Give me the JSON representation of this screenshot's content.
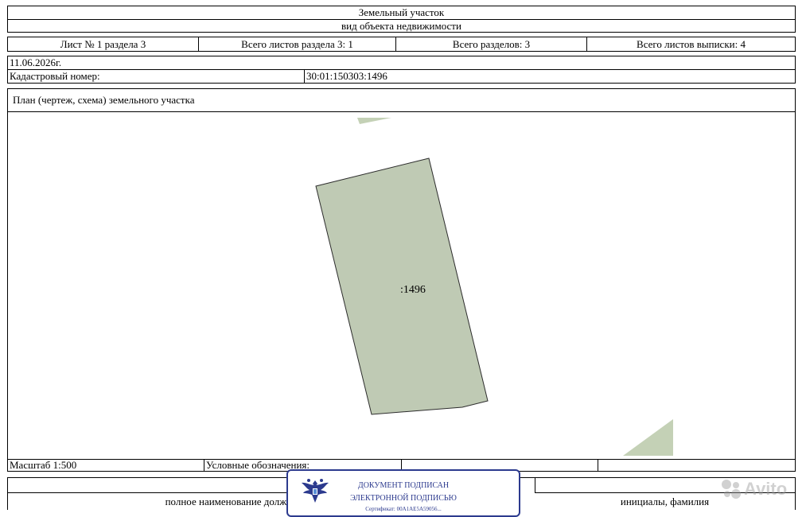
{
  "header": {
    "object_type": "Земельный участок",
    "object_type_caption": "вид объекта недвижимости"
  },
  "sheet_info": {
    "sheet": "Лист № 1 раздела 3",
    "sheets_in_section": "Всего листов раздела 3: 1",
    "sections_total": "Всего разделов: 3",
    "sheets_total": "Всего листов выписки: 4"
  },
  "date": "11.06.2026г.",
  "cadastral": {
    "label": "Кадастровый номер:",
    "value": "30:01:150303:1496"
  },
  "plan": {
    "title": "План (чертеж, схема) земельного участка",
    "parcel_label": ":1496",
    "parcel_color": "#bfcab4",
    "neighbor_color": "#c4d1b6"
  },
  "footer": {
    "scale": "Масштаб 1:500",
    "legend_label": "Условные обозначения:",
    "position_label": "полное наименование должности",
    "initials_label": "инициалы, фамилия"
  },
  "stamp": {
    "line1": "ДОКУМЕНТ ПОДПИСАН",
    "line2": "ЭЛЕКТРОННОЙ ПОДПИСЬЮ",
    "line3": "Сертификат: 00A1AE5A59056... ",
    "color": "#2c3a8e",
    "emblem_icon": "double-headed-eagle-icon"
  },
  "watermark": {
    "text": "Avito"
  }
}
